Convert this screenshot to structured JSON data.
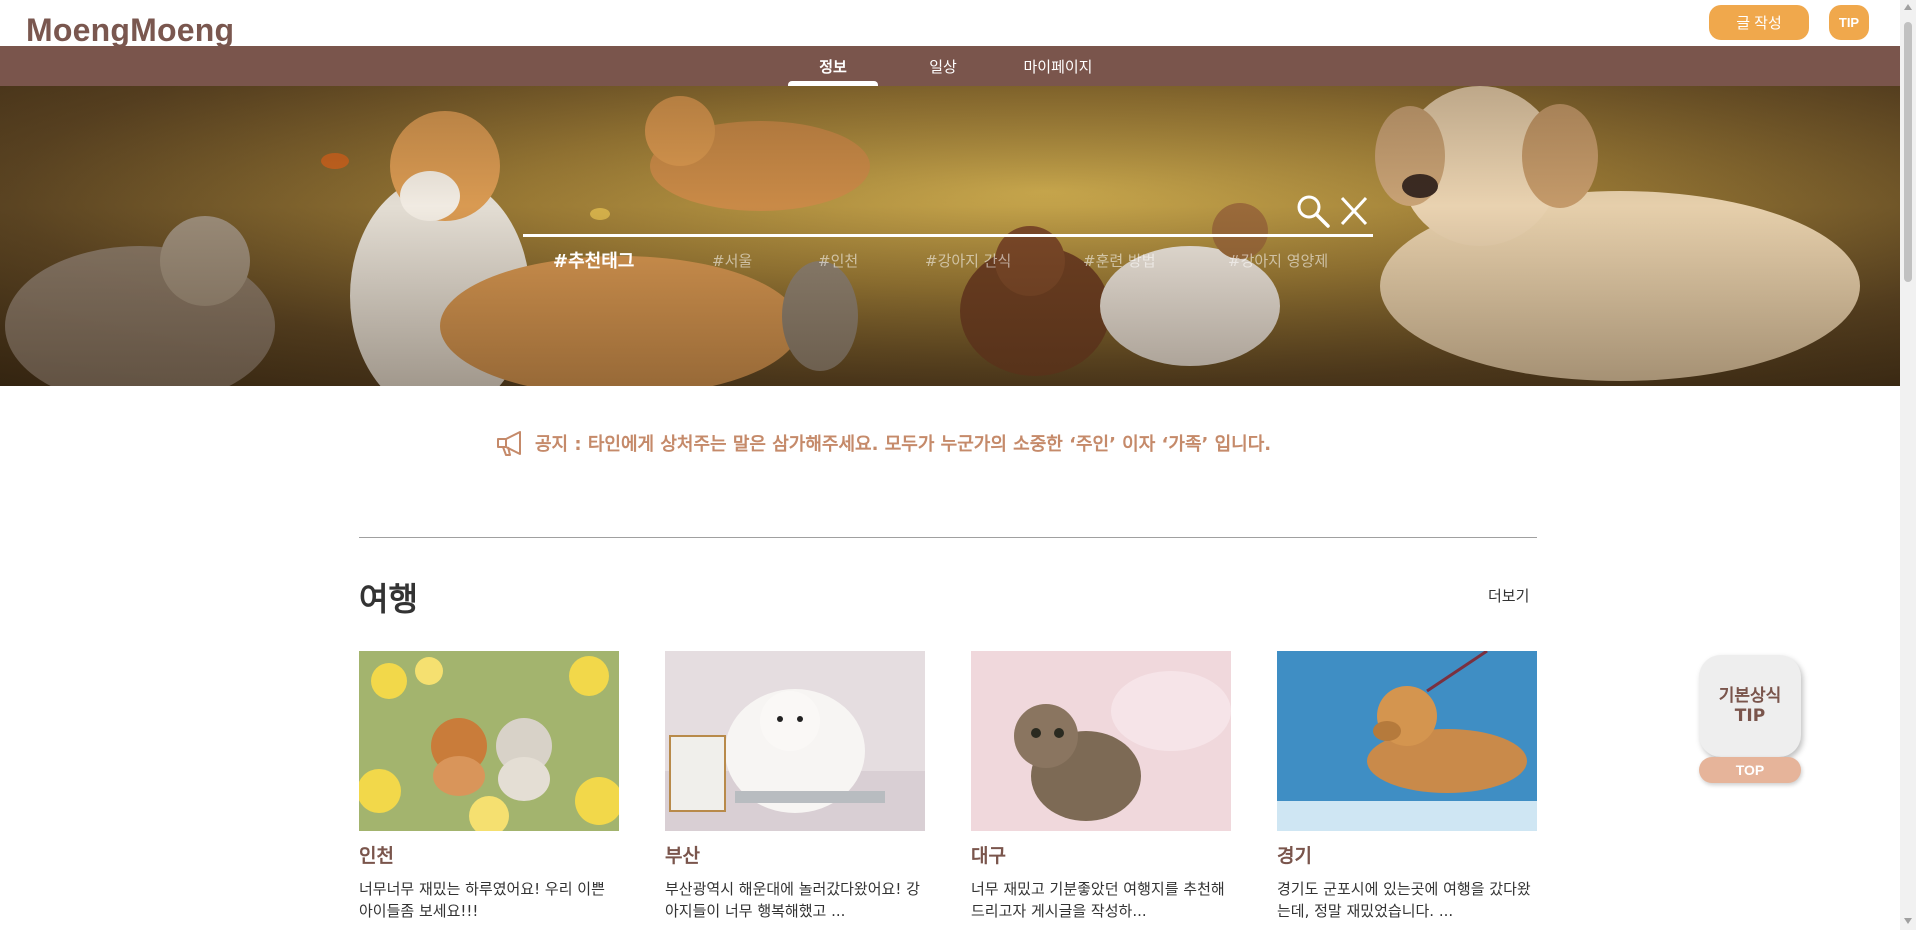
{
  "app": {
    "logo": "MoengMoeng"
  },
  "header": {
    "write_label": "글 작성",
    "tip_label": "TIP"
  },
  "nav": {
    "items": [
      {
        "label": "정보"
      },
      {
        "label": "일상"
      },
      {
        "label": "마이페이지"
      }
    ],
    "active": "정보"
  },
  "hero": {
    "search": {
      "value": ""
    },
    "tags_title": "#추천태그",
    "tags": [
      "#서울",
      "#인천",
      "#강아지 간식",
      "#훈련 방법",
      "#강아지 영양제"
    ]
  },
  "notice": {
    "text": "공지 : 타인에게 상처주는 말은 삼가해주세요. 모두가 누군가의 소중한 ‘주인’ 이자 ‘가족’ 입니다."
  },
  "section": {
    "title": "여행",
    "more_label": "더보기",
    "cards": [
      {
        "title": "인천",
        "desc": "너무너무 재밌는 하루였어요! 우리 이쁜 아이들좀 보세요!!!"
      },
      {
        "title": "부산",
        "desc": "부산광역시 해운대에 놀러갔다왔어요! 강아지들이 너무 행복해했고 ..."
      },
      {
        "title": "대구",
        "desc": "너무 재밌고 기분좋았던 여행지를 추천해드리고자 게시글을 작성하..."
      },
      {
        "title": "경기",
        "desc": "경기도 군포시에 있는곳에 여행을 갔다왔는데, 정말 재밌었습니다. ..."
      }
    ]
  },
  "floating": {
    "tip_line1": "기본상식",
    "tip_line2": "TIP",
    "top_label": "TOP"
  },
  "colors": {
    "brand_brown": "#7a554c",
    "accent_orange": "#f0a84c",
    "notice": "#c58a6a"
  }
}
